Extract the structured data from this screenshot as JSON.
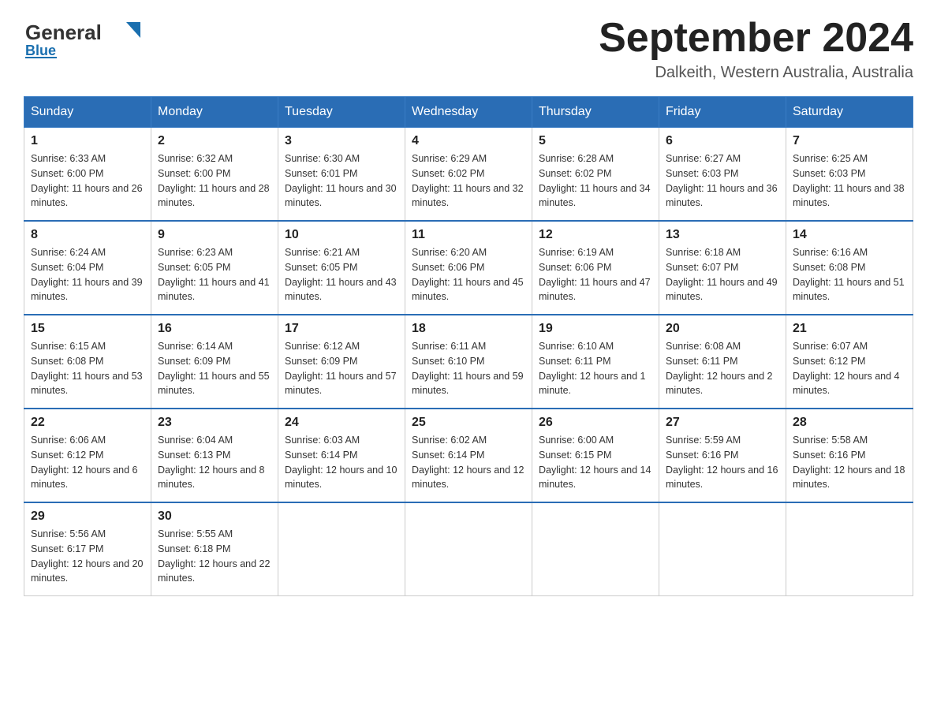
{
  "header": {
    "logo_general": "General",
    "logo_blue": "Blue",
    "calendar_title": "September 2024",
    "calendar_subtitle": "Dalkeith, Western Australia, Australia"
  },
  "weekdays": [
    "Sunday",
    "Monday",
    "Tuesday",
    "Wednesday",
    "Thursday",
    "Friday",
    "Saturday"
  ],
  "weeks": [
    [
      {
        "day": "1",
        "sunrise": "6:33 AM",
        "sunset": "6:00 PM",
        "daylight": "11 hours and 26 minutes."
      },
      {
        "day": "2",
        "sunrise": "6:32 AM",
        "sunset": "6:00 PM",
        "daylight": "11 hours and 28 minutes."
      },
      {
        "day": "3",
        "sunrise": "6:30 AM",
        "sunset": "6:01 PM",
        "daylight": "11 hours and 30 minutes."
      },
      {
        "day": "4",
        "sunrise": "6:29 AM",
        "sunset": "6:02 PM",
        "daylight": "11 hours and 32 minutes."
      },
      {
        "day": "5",
        "sunrise": "6:28 AM",
        "sunset": "6:02 PM",
        "daylight": "11 hours and 34 minutes."
      },
      {
        "day": "6",
        "sunrise": "6:27 AM",
        "sunset": "6:03 PM",
        "daylight": "11 hours and 36 minutes."
      },
      {
        "day": "7",
        "sunrise": "6:25 AM",
        "sunset": "6:03 PM",
        "daylight": "11 hours and 38 minutes."
      }
    ],
    [
      {
        "day": "8",
        "sunrise": "6:24 AM",
        "sunset": "6:04 PM",
        "daylight": "11 hours and 39 minutes."
      },
      {
        "day": "9",
        "sunrise": "6:23 AM",
        "sunset": "6:05 PM",
        "daylight": "11 hours and 41 minutes."
      },
      {
        "day": "10",
        "sunrise": "6:21 AM",
        "sunset": "6:05 PM",
        "daylight": "11 hours and 43 minutes."
      },
      {
        "day": "11",
        "sunrise": "6:20 AM",
        "sunset": "6:06 PM",
        "daylight": "11 hours and 45 minutes."
      },
      {
        "day": "12",
        "sunrise": "6:19 AM",
        "sunset": "6:06 PM",
        "daylight": "11 hours and 47 minutes."
      },
      {
        "day": "13",
        "sunrise": "6:18 AM",
        "sunset": "6:07 PM",
        "daylight": "11 hours and 49 minutes."
      },
      {
        "day": "14",
        "sunrise": "6:16 AM",
        "sunset": "6:08 PM",
        "daylight": "11 hours and 51 minutes."
      }
    ],
    [
      {
        "day": "15",
        "sunrise": "6:15 AM",
        "sunset": "6:08 PM",
        "daylight": "11 hours and 53 minutes."
      },
      {
        "day": "16",
        "sunrise": "6:14 AM",
        "sunset": "6:09 PM",
        "daylight": "11 hours and 55 minutes."
      },
      {
        "day": "17",
        "sunrise": "6:12 AM",
        "sunset": "6:09 PM",
        "daylight": "11 hours and 57 minutes."
      },
      {
        "day": "18",
        "sunrise": "6:11 AM",
        "sunset": "6:10 PM",
        "daylight": "11 hours and 59 minutes."
      },
      {
        "day": "19",
        "sunrise": "6:10 AM",
        "sunset": "6:11 PM",
        "daylight": "12 hours and 1 minute."
      },
      {
        "day": "20",
        "sunrise": "6:08 AM",
        "sunset": "6:11 PM",
        "daylight": "12 hours and 2 minutes."
      },
      {
        "day": "21",
        "sunrise": "6:07 AM",
        "sunset": "6:12 PM",
        "daylight": "12 hours and 4 minutes."
      }
    ],
    [
      {
        "day": "22",
        "sunrise": "6:06 AM",
        "sunset": "6:12 PM",
        "daylight": "12 hours and 6 minutes."
      },
      {
        "day": "23",
        "sunrise": "6:04 AM",
        "sunset": "6:13 PM",
        "daylight": "12 hours and 8 minutes."
      },
      {
        "day": "24",
        "sunrise": "6:03 AM",
        "sunset": "6:14 PM",
        "daylight": "12 hours and 10 minutes."
      },
      {
        "day": "25",
        "sunrise": "6:02 AM",
        "sunset": "6:14 PM",
        "daylight": "12 hours and 12 minutes."
      },
      {
        "day": "26",
        "sunrise": "6:00 AM",
        "sunset": "6:15 PM",
        "daylight": "12 hours and 14 minutes."
      },
      {
        "day": "27",
        "sunrise": "5:59 AM",
        "sunset": "6:16 PM",
        "daylight": "12 hours and 16 minutes."
      },
      {
        "day": "28",
        "sunrise": "5:58 AM",
        "sunset": "6:16 PM",
        "daylight": "12 hours and 18 minutes."
      }
    ],
    [
      {
        "day": "29",
        "sunrise": "5:56 AM",
        "sunset": "6:17 PM",
        "daylight": "12 hours and 20 minutes."
      },
      {
        "day": "30",
        "sunrise": "5:55 AM",
        "sunset": "6:18 PM",
        "daylight": "12 hours and 22 minutes."
      },
      null,
      null,
      null,
      null,
      null
    ]
  ]
}
